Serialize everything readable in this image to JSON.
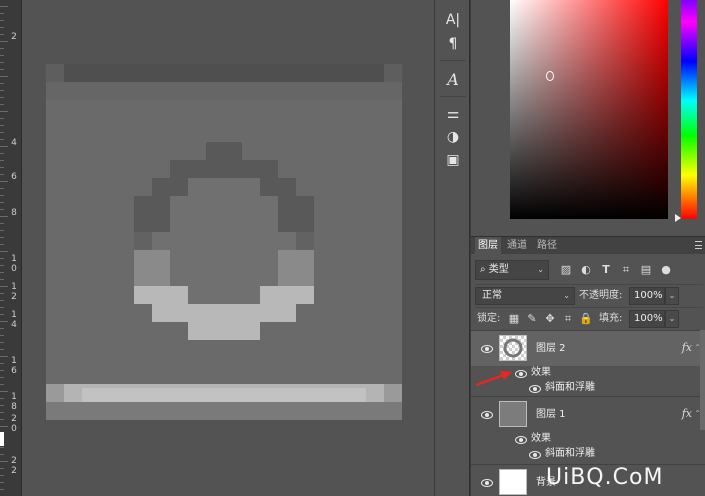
{
  "ruler": {
    "labels": [
      "2",
      "4",
      "6",
      "8",
      "1\n0",
      "1\n2",
      "1\n4",
      "1\n6",
      "1\n8",
      "2\n0",
      "2\n2"
    ]
  },
  "toolstrip": {
    "tools": [
      {
        "name": "character-panel-icon",
        "glyph": "A|"
      },
      {
        "name": "paragraph-panel-icon",
        "glyph": "¶"
      },
      {
        "name": "glyphs-panel-icon",
        "glyph": "A"
      },
      {
        "name": "adjustments-panel-icon",
        "glyph": "⚌"
      },
      {
        "name": "styles-panel-icon",
        "glyph": "◑"
      },
      {
        "name": "properties-panel-icon",
        "glyph": "▣"
      }
    ]
  },
  "color_panel": {
    "hue_color": "#ff0000"
  },
  "layers_panel": {
    "tabs": [
      {
        "label": "图层",
        "active": true
      },
      {
        "label": "通道",
        "active": false
      },
      {
        "label": "路径",
        "active": false
      }
    ],
    "filter": {
      "label": "类型",
      "icon": "search-icon"
    },
    "filter_icons": [
      "image-filter-icon",
      "adjustment-filter-icon",
      "type-filter-icon",
      "shape-filter-icon",
      "smart-object-filter-icon",
      "filter-toggle-icon"
    ],
    "blend_mode": "正常",
    "opacity_label": "不透明度:",
    "opacity_value": "100%",
    "lock_label": "锁定:",
    "lock_icons": [
      "lock-transparent-icon",
      "lock-image-icon",
      "lock-position-icon",
      "lock-artboard-icon",
      "lock-all-icon"
    ],
    "fill_label": "填充:",
    "fill_value": "100%",
    "layers": [
      {
        "name": "图层 2",
        "thumb": "transparent",
        "fx": "fx",
        "selected": true,
        "effects_label": "效果",
        "effects": [
          "斜面和浮雕"
        ]
      },
      {
        "name": "图层 1",
        "thumb": "gray",
        "fx": "fx",
        "selected": false,
        "effects_label": "效果",
        "effects": [
          "斜面和浮雕"
        ]
      },
      {
        "name": "背景",
        "thumb": "white",
        "fx": "",
        "selected": false
      }
    ]
  },
  "watermark": "UiBQ.CoM",
  "colors": {
    "panel_bg": "#535353",
    "arrow": "#e8281e"
  }
}
